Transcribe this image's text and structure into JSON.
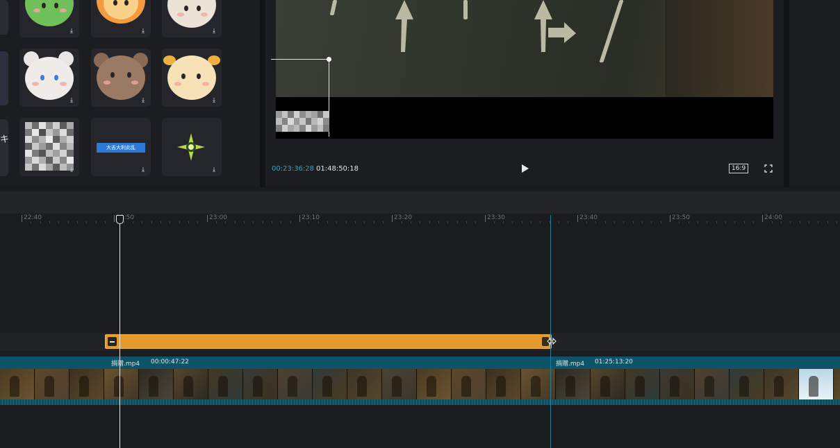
{
  "sticker_panel": {
    "download_glyph": "⤓",
    "items": [
      {
        "name": "frog-sticker"
      },
      {
        "name": "lion-sticker"
      },
      {
        "name": "sheep-sticker"
      },
      {
        "name": "cat-sticker"
      },
      {
        "name": "bear-sticker"
      },
      {
        "name": "cow-sticker"
      },
      {
        "name": "mosaic-sticker"
      },
      {
        "name": "caption-tag-sticker",
        "text": "大吉大利此乱"
      },
      {
        "name": "sparkle-sticker"
      }
    ],
    "edge_glyph": "キ"
  },
  "preview": {
    "current_time": "00:23:36:28",
    "total_time": "01:48:50:18",
    "aspect_ratio": "16:9",
    "play_icon": "play-icon",
    "fullscreen_icon": "fullscreen-icon"
  },
  "timeline": {
    "ruler_labels": [
      "22:40",
      "22:50",
      "23:00",
      "23:10",
      "23:20",
      "23:30",
      "23:40",
      "23:50",
      "24:00"
    ],
    "video_clips": [
      {
        "name": "捐赠.mp4",
        "duration": "00:00:47:22"
      },
      {
        "name": "捐赠.mp4",
        "duration": "01:25:13:20"
      }
    ]
  },
  "colors": {
    "accent": "#2aa9c7",
    "sticker_clip": "#e59a2c",
    "video_track": "#0e5367"
  }
}
